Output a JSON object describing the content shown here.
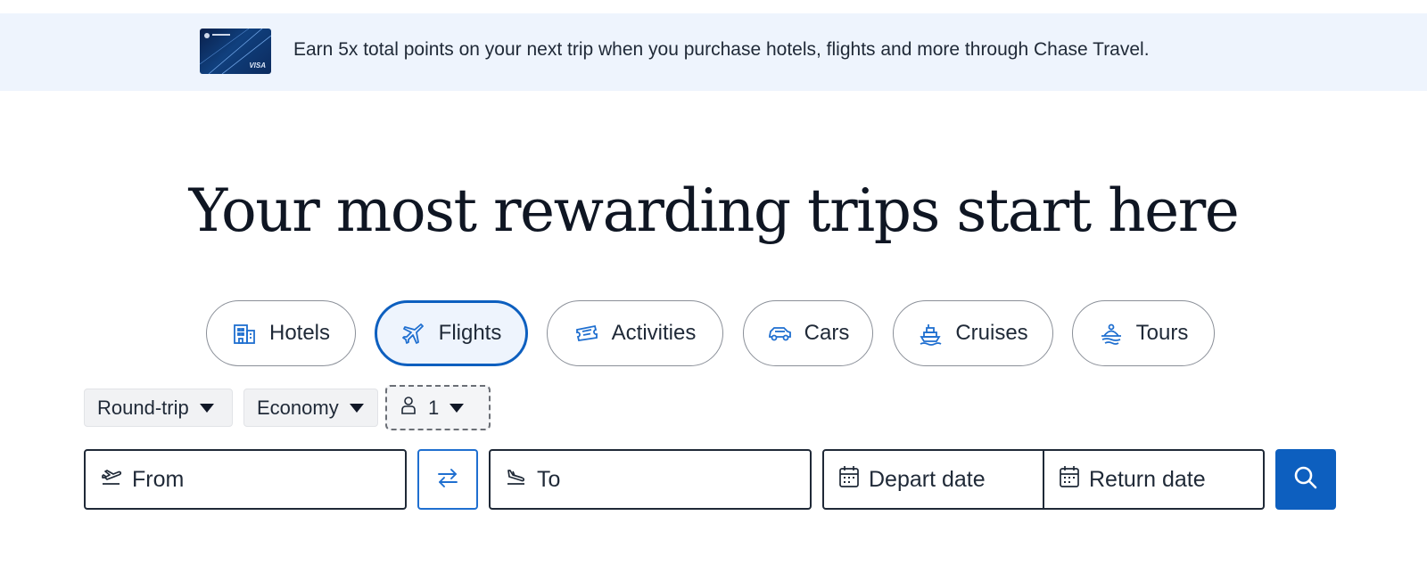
{
  "banner": {
    "text": "Earn 5x total points on your next trip when you purchase hotels, flights and more through Chase Travel.",
    "card_brand": "VISA"
  },
  "headline": "Your most rewarding trips start here",
  "tabs": [
    {
      "label": "Hotels",
      "icon": "hotel-icon",
      "active": false
    },
    {
      "label": "Flights",
      "icon": "plane-icon",
      "active": true
    },
    {
      "label": "Activities",
      "icon": "ticket-icon",
      "active": false
    },
    {
      "label": "Cars",
      "icon": "car-icon",
      "active": false
    },
    {
      "label": "Cruises",
      "icon": "ship-icon",
      "active": false
    },
    {
      "label": "Tours",
      "icon": "tour-icon",
      "active": false
    }
  ],
  "options": {
    "trip_type": "Round-trip",
    "cabin_class": "Economy",
    "travelers": "1"
  },
  "search": {
    "from_placeholder": "From",
    "to_placeholder": "To",
    "depart_placeholder": "Depart date",
    "return_placeholder": "Return date"
  },
  "colors": {
    "accent": "#0d5fbf",
    "banner_bg": "#eef4fd",
    "active_tab_bg": "#eef4fd"
  }
}
